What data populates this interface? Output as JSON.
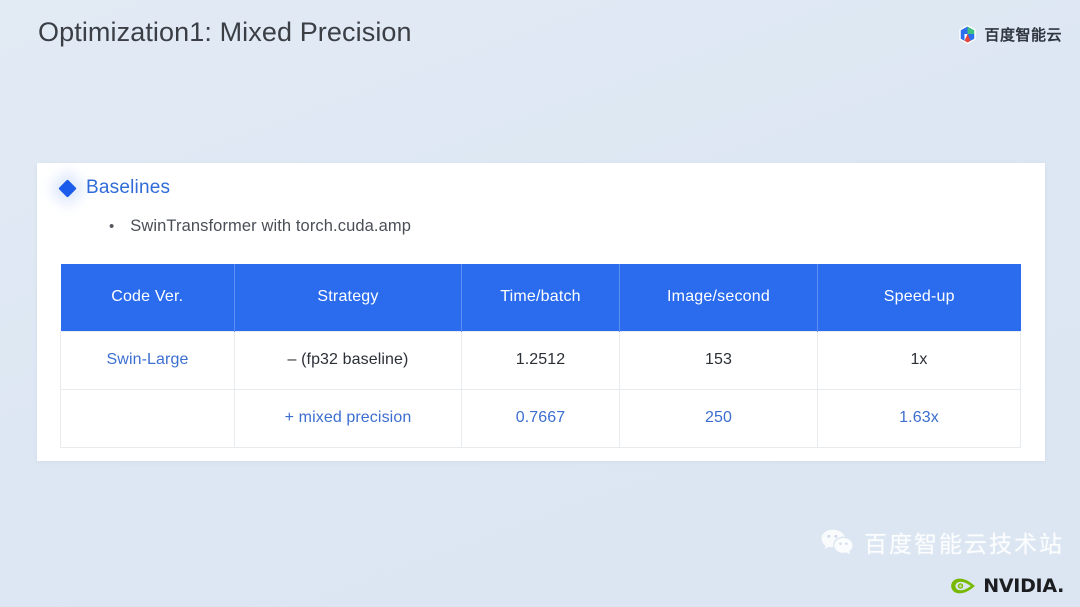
{
  "slide": {
    "title": "Optimization1: Mixed Precision",
    "background_color": "#dfe8f3",
    "accent_color": "#2a6ced"
  },
  "brand_topright": {
    "logo_icon": "baidu-hexagon-icon",
    "text": "百度智能云"
  },
  "card": {
    "bullet": {
      "icon": "diamond-bullet-icon",
      "label": "Baselines"
    },
    "sub_bullet": {
      "icon": "dot-bullet-icon",
      "marker": "•",
      "label": "SwinTransformer with torch.cuda.amp"
    }
  },
  "table": {
    "headers": [
      "Code Ver.",
      "Strategy",
      "Time/batch",
      "Image/second",
      "Speed-up"
    ],
    "rows": [
      {
        "code_ver": "Swin-Large",
        "strategy": "– (fp32 baseline)",
        "time_batch": "1.2512",
        "image_second": "153",
        "speed_up": "1x"
      },
      {
        "code_ver": "",
        "strategy": "+ mixed precision",
        "time_batch": "0.7667",
        "image_second": "250",
        "speed_up": "1.63x"
      }
    ]
  },
  "footer": {
    "wechat_icon": "wechat-icon",
    "wechat_text": "百度智能云技术站",
    "nvidia_icon": "nvidia-eye-icon",
    "nvidia_text": "NVIDIA."
  }
}
